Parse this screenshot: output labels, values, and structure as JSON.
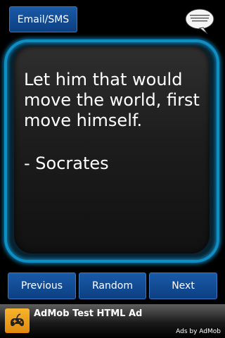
{
  "toolbar": {
    "share_label": "Email/SMS",
    "bubble_icon": "speech-bubble-icon"
  },
  "quote": {
    "text": "Let him that would move the world, first move himself.",
    "author": "- Socrates"
  },
  "nav": {
    "previous_label": "Previous",
    "random_label": "Random",
    "next_label": "Next"
  },
  "ad": {
    "title": "AdMob Test HTML Ad",
    "attribution": "Ads by AdMob",
    "icon": "gamepad-icon"
  },
  "colors": {
    "background": "#000000",
    "button": "#0c3f82",
    "frame_glow": "#0d8fc4",
    "ad_icon": "#f0a020"
  }
}
